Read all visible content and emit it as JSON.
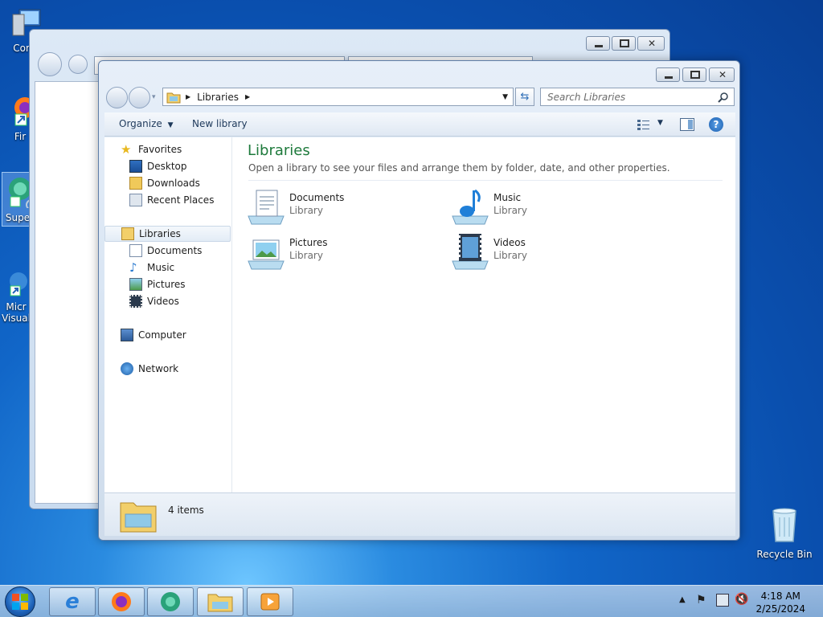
{
  "desktop": {
    "icons": [
      {
        "label": "Com"
      },
      {
        "label": "Fir"
      },
      {
        "label": "Supe"
      },
      {
        "label": "Micr\nVisual"
      },
      {
        "label": "Recycle Bin"
      }
    ]
  },
  "window": {
    "breadcrumb": [
      "Libraries"
    ],
    "search_placeholder": "Search Libraries",
    "toolbar": {
      "organize": "Organize",
      "new_library": "New library"
    },
    "nav": {
      "favorites": "Favorites",
      "favorites_items": [
        "Desktop",
        "Downloads",
        "Recent Places"
      ],
      "libraries": "Libraries",
      "libraries_items": [
        "Documents",
        "Music",
        "Pictures",
        "Videos"
      ],
      "computer": "Computer",
      "network": "Network"
    },
    "main": {
      "title": "Libraries",
      "subtitle": "Open a library to see your files and arrange them by folder, date, and other properties.",
      "items": [
        {
          "name": "Documents",
          "type": "Library"
        },
        {
          "name": "Music",
          "type": "Library"
        },
        {
          "name": "Pictures",
          "type": "Library"
        },
        {
          "name": "Videos",
          "type": "Library"
        }
      ]
    },
    "status": {
      "count": "4 items"
    }
  },
  "taskbar": {
    "clock_time": "4:18 AM",
    "clock_date": "2/25/2024"
  },
  "colors": {
    "title_green": "#1e7a3c",
    "link_blue": "#1e395b"
  }
}
